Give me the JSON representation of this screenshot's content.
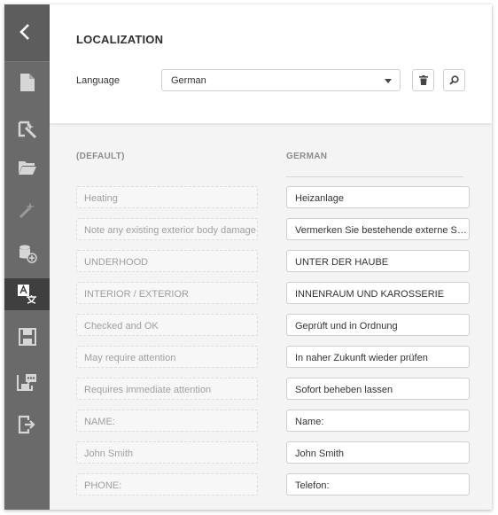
{
  "panel": {
    "title": "LOCALIZATION",
    "language_label": "Language",
    "language_selected": "German"
  },
  "columns": {
    "default_header": "(DEFAULT)",
    "translation_header": "GERMAN"
  },
  "rows": [
    {
      "default": "Heating",
      "translation": "Heizanlage"
    },
    {
      "default": "Note any existing exterior body damage",
      "translation": "Vermerken Sie bestehende externe Schäden"
    },
    {
      "default": "UNDERHOOD",
      "translation": "UNTER DER HAUBE"
    },
    {
      "default": "INTERIOR / EXTERIOR",
      "translation": "INNENRAUM UND KAROSSERIE"
    },
    {
      "default": "Checked and OK",
      "translation": "Geprüft und in Ordnung"
    },
    {
      "default": "May require attention",
      "translation": "In naher Zukunft wieder prüfen"
    },
    {
      "default": "Requires immediate attention",
      "translation": "Sofort beheben lassen"
    },
    {
      "default": "NAME:",
      "translation": "Name:"
    },
    {
      "default": "John Smith",
      "translation": "John Smith"
    },
    {
      "default": "PHONE:",
      "translation": "Telefon:"
    }
  ],
  "sidebar_icons": [
    "back-chevron-icon",
    "new-report-icon",
    "report-wizard-icon",
    "open-folder-icon",
    "magic-wand-icon",
    "add-datasource-icon",
    "localization-icon",
    "save-icon",
    "save-as-icon",
    "exit-icon"
  ],
  "colors": {
    "sidebar": "#6a6a6a",
    "sidebar_active": "#3f3f3f",
    "panel_bg": "#f4f4f4"
  }
}
